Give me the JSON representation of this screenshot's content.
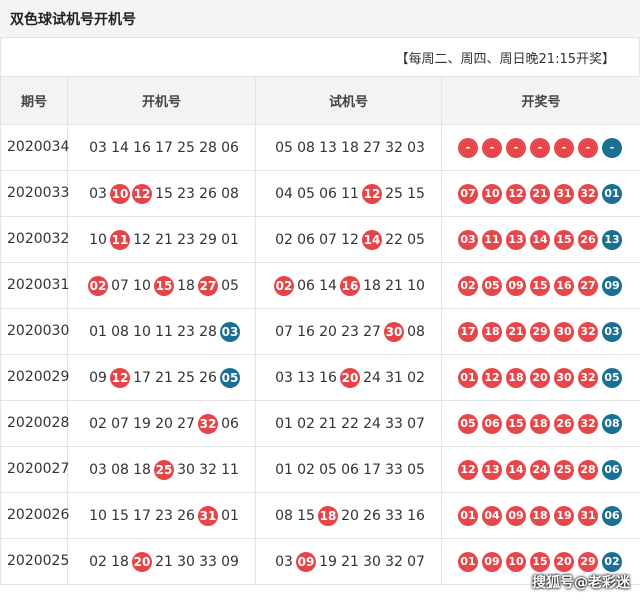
{
  "title": "双色球试机号开机号",
  "notice": "【每周二、周四、周日晚21:15开奖】",
  "headers": {
    "issue": "期号",
    "open": "开机号",
    "trial": "试机号",
    "prize": "开奖号"
  },
  "colors": {
    "red_ball": "#e5474a",
    "blue_ball": "#1b6f93",
    "header_bg": "#f3f3f3"
  },
  "rows": [
    {
      "issue": "2020034",
      "open": [
        [
          "03",
          ""
        ],
        [
          "14",
          ""
        ],
        [
          "16",
          ""
        ],
        [
          "17",
          ""
        ],
        [
          "25",
          ""
        ],
        [
          "28",
          ""
        ],
        [
          "06",
          ""
        ]
      ],
      "trial": [
        [
          "05",
          ""
        ],
        [
          "08",
          ""
        ],
        [
          "13",
          ""
        ],
        [
          "18",
          ""
        ],
        [
          "27",
          ""
        ],
        [
          "32",
          ""
        ],
        [
          "03",
          ""
        ]
      ],
      "prize": [
        [
          "-",
          "red"
        ],
        [
          "-",
          "red"
        ],
        [
          "-",
          "red"
        ],
        [
          "-",
          "red"
        ],
        [
          "-",
          "red"
        ],
        [
          "-",
          "red"
        ],
        [
          "-",
          "blue"
        ]
      ]
    },
    {
      "issue": "2020033",
      "open": [
        [
          "03",
          ""
        ],
        [
          "10",
          "red"
        ],
        [
          "12",
          "red"
        ],
        [
          "15",
          ""
        ],
        [
          "23",
          ""
        ],
        [
          "26",
          ""
        ],
        [
          "08",
          ""
        ]
      ],
      "trial": [
        [
          "04",
          ""
        ],
        [
          "05",
          ""
        ],
        [
          "06",
          ""
        ],
        [
          "11",
          ""
        ],
        [
          "12",
          "red"
        ],
        [
          "25",
          ""
        ],
        [
          "15",
          ""
        ]
      ],
      "prize": [
        [
          "07",
          "red"
        ],
        [
          "10",
          "red"
        ],
        [
          "12",
          "red"
        ],
        [
          "21",
          "red"
        ],
        [
          "31",
          "red"
        ],
        [
          "32",
          "red"
        ],
        [
          "01",
          "blue"
        ]
      ]
    },
    {
      "issue": "2020032",
      "open": [
        [
          "10",
          ""
        ],
        [
          "11",
          "red"
        ],
        [
          "12",
          ""
        ],
        [
          "21",
          ""
        ],
        [
          "23",
          ""
        ],
        [
          "29",
          ""
        ],
        [
          "01",
          ""
        ]
      ],
      "trial": [
        [
          "02",
          ""
        ],
        [
          "06",
          ""
        ],
        [
          "07",
          ""
        ],
        [
          "12",
          ""
        ],
        [
          "14",
          "red"
        ],
        [
          "22",
          ""
        ],
        [
          "05",
          ""
        ]
      ],
      "prize": [
        [
          "03",
          "red"
        ],
        [
          "11",
          "red"
        ],
        [
          "13",
          "red"
        ],
        [
          "14",
          "red"
        ],
        [
          "15",
          "red"
        ],
        [
          "26",
          "red"
        ],
        [
          "13",
          "blue"
        ]
      ]
    },
    {
      "issue": "2020031",
      "open": [
        [
          "02",
          "red"
        ],
        [
          "07",
          ""
        ],
        [
          "10",
          ""
        ],
        [
          "15",
          "red"
        ],
        [
          "18",
          ""
        ],
        [
          "27",
          "red"
        ],
        [
          "05",
          ""
        ]
      ],
      "trial": [
        [
          "02",
          "red"
        ],
        [
          "06",
          ""
        ],
        [
          "14",
          ""
        ],
        [
          "16",
          "red"
        ],
        [
          "18",
          ""
        ],
        [
          "21",
          ""
        ],
        [
          "10",
          ""
        ]
      ],
      "prize": [
        [
          "02",
          "red"
        ],
        [
          "05",
          "red"
        ],
        [
          "09",
          "red"
        ],
        [
          "15",
          "red"
        ],
        [
          "16",
          "red"
        ],
        [
          "27",
          "red"
        ],
        [
          "09",
          "blue"
        ]
      ]
    },
    {
      "issue": "2020030",
      "open": [
        [
          "01",
          ""
        ],
        [
          "08",
          ""
        ],
        [
          "10",
          ""
        ],
        [
          "11",
          ""
        ],
        [
          "23",
          ""
        ],
        [
          "28",
          ""
        ],
        [
          "03",
          "blue"
        ]
      ],
      "trial": [
        [
          "07",
          ""
        ],
        [
          "16",
          ""
        ],
        [
          "20",
          ""
        ],
        [
          "23",
          ""
        ],
        [
          "27",
          ""
        ],
        [
          "30",
          "red"
        ],
        [
          "08",
          ""
        ]
      ],
      "prize": [
        [
          "17",
          "red"
        ],
        [
          "18",
          "red"
        ],
        [
          "21",
          "red"
        ],
        [
          "29",
          "red"
        ],
        [
          "30",
          "red"
        ],
        [
          "32",
          "red"
        ],
        [
          "03",
          "blue"
        ]
      ]
    },
    {
      "issue": "2020029",
      "open": [
        [
          "09",
          ""
        ],
        [
          "12",
          "red"
        ],
        [
          "17",
          ""
        ],
        [
          "21",
          ""
        ],
        [
          "25",
          ""
        ],
        [
          "26",
          ""
        ],
        [
          "05",
          "blue"
        ]
      ],
      "trial": [
        [
          "03",
          ""
        ],
        [
          "13",
          ""
        ],
        [
          "16",
          ""
        ],
        [
          "20",
          "red"
        ],
        [
          "24",
          ""
        ],
        [
          "31",
          ""
        ],
        [
          "02",
          ""
        ]
      ],
      "prize": [
        [
          "01",
          "red"
        ],
        [
          "12",
          "red"
        ],
        [
          "18",
          "red"
        ],
        [
          "20",
          "red"
        ],
        [
          "30",
          "red"
        ],
        [
          "32",
          "red"
        ],
        [
          "05",
          "blue"
        ]
      ]
    },
    {
      "issue": "2020028",
      "open": [
        [
          "02",
          ""
        ],
        [
          "07",
          ""
        ],
        [
          "19",
          ""
        ],
        [
          "20",
          ""
        ],
        [
          "27",
          ""
        ],
        [
          "32",
          "red"
        ],
        [
          "06",
          ""
        ]
      ],
      "trial": [
        [
          "01",
          ""
        ],
        [
          "02",
          ""
        ],
        [
          "21",
          ""
        ],
        [
          "22",
          ""
        ],
        [
          "24",
          ""
        ],
        [
          "33",
          ""
        ],
        [
          "07",
          ""
        ]
      ],
      "prize": [
        [
          "05",
          "red"
        ],
        [
          "06",
          "red"
        ],
        [
          "15",
          "red"
        ],
        [
          "18",
          "red"
        ],
        [
          "26",
          "red"
        ],
        [
          "32",
          "red"
        ],
        [
          "08",
          "blue"
        ]
      ]
    },
    {
      "issue": "2020027",
      "open": [
        [
          "03",
          ""
        ],
        [
          "08",
          ""
        ],
        [
          "18",
          ""
        ],
        [
          "25",
          "red"
        ],
        [
          "30",
          ""
        ],
        [
          "32",
          ""
        ],
        [
          "11",
          ""
        ]
      ],
      "trial": [
        [
          "01",
          ""
        ],
        [
          "02",
          ""
        ],
        [
          "05",
          ""
        ],
        [
          "06",
          ""
        ],
        [
          "17",
          ""
        ],
        [
          "33",
          ""
        ],
        [
          "05",
          ""
        ]
      ],
      "prize": [
        [
          "12",
          "red"
        ],
        [
          "13",
          "red"
        ],
        [
          "14",
          "red"
        ],
        [
          "24",
          "red"
        ],
        [
          "25",
          "red"
        ],
        [
          "28",
          "red"
        ],
        [
          "06",
          "blue"
        ]
      ]
    },
    {
      "issue": "2020026",
      "open": [
        [
          "10",
          ""
        ],
        [
          "15",
          ""
        ],
        [
          "17",
          ""
        ],
        [
          "23",
          ""
        ],
        [
          "26",
          ""
        ],
        [
          "31",
          "red"
        ],
        [
          "01",
          ""
        ]
      ],
      "trial": [
        [
          "08",
          ""
        ],
        [
          "15",
          ""
        ],
        [
          "18",
          "red"
        ],
        [
          "20",
          ""
        ],
        [
          "26",
          ""
        ],
        [
          "33",
          ""
        ],
        [
          "16",
          ""
        ]
      ],
      "prize": [
        [
          "01",
          "red"
        ],
        [
          "04",
          "red"
        ],
        [
          "09",
          "red"
        ],
        [
          "18",
          "red"
        ],
        [
          "19",
          "red"
        ],
        [
          "31",
          "red"
        ],
        [
          "06",
          "blue"
        ]
      ]
    },
    {
      "issue": "2020025",
      "open": [
        [
          "02",
          ""
        ],
        [
          "18",
          ""
        ],
        [
          "20",
          "red"
        ],
        [
          "21",
          ""
        ],
        [
          "30",
          ""
        ],
        [
          "33",
          ""
        ],
        [
          "09",
          ""
        ]
      ],
      "trial": [
        [
          "03",
          ""
        ],
        [
          "09",
          "red"
        ],
        [
          "19",
          ""
        ],
        [
          "21",
          ""
        ],
        [
          "30",
          ""
        ],
        [
          "32",
          ""
        ],
        [
          "07",
          ""
        ]
      ],
      "prize": [
        [
          "01",
          "red"
        ],
        [
          "09",
          "red"
        ],
        [
          "10",
          "red"
        ],
        [
          "15",
          "red"
        ],
        [
          "20",
          "red"
        ],
        [
          "29",
          "red"
        ],
        [
          "02",
          "blue"
        ]
      ]
    }
  ],
  "watermark": "搜狐号@老彩迷"
}
